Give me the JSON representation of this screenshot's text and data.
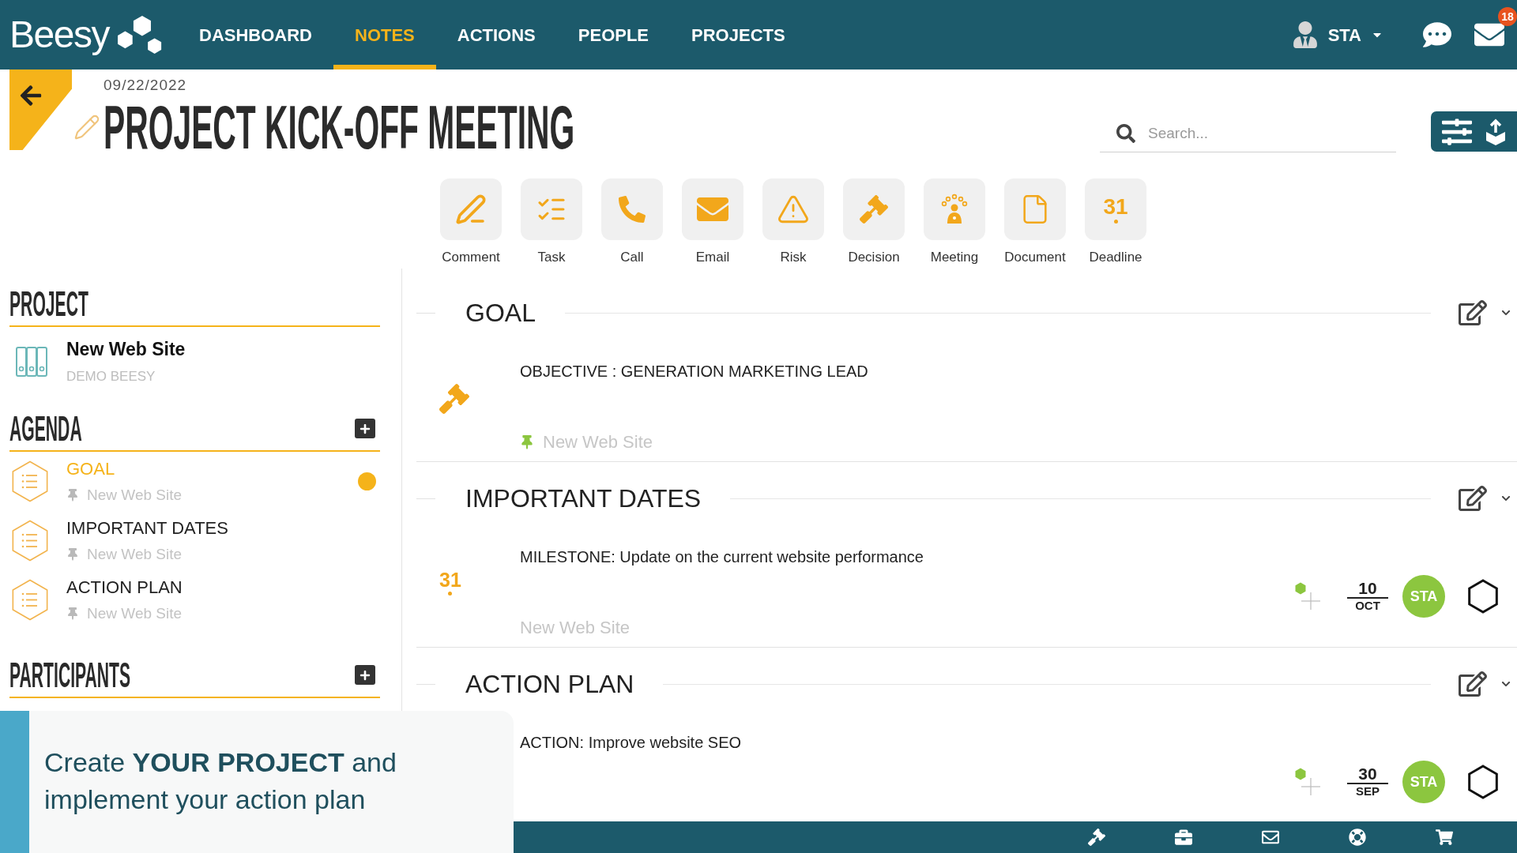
{
  "nav": {
    "logo": "Beesy",
    "items": [
      {
        "label": "DASHBOARD",
        "selected": false
      },
      {
        "label": "NOTES",
        "selected": true
      },
      {
        "label": "ACTIONS",
        "selected": false
      },
      {
        "label": "PEOPLE",
        "selected": false
      },
      {
        "label": "PROJECTS",
        "selected": false
      }
    ],
    "user": "STA",
    "mail_badge": "18"
  },
  "header": {
    "date": "09/22/2022",
    "title": "PROJECT KICK-OFF MEETING",
    "search": {
      "placeholder": "Search..."
    }
  },
  "toolbar": [
    {
      "label": "Comment"
    },
    {
      "label": "Task"
    },
    {
      "label": "Call"
    },
    {
      "label": "Email"
    },
    {
      "label": "Risk"
    },
    {
      "label": "Decision"
    },
    {
      "label": "Meeting"
    },
    {
      "label": "Document"
    },
    {
      "label": "Deadline",
      "icon_text": "31"
    }
  ],
  "sidebar": {
    "project": {
      "heading": "PROJECT",
      "name": "New Web Site",
      "client": "DEMO BEESY"
    },
    "agenda": {
      "heading": "AGENDA",
      "items": [
        {
          "title": "GOAL",
          "project": "New Web Site",
          "selected": true
        },
        {
          "title": "IMPORTANT DATES",
          "project": "New Web Site",
          "selected": false
        },
        {
          "title": "ACTION PLAN",
          "project": "New Web Site",
          "selected": false
        }
      ]
    },
    "participants": {
      "heading": "PARTICIPANTS"
    }
  },
  "sections": [
    {
      "title": "GOAL",
      "items": [
        {
          "kind": "decision",
          "text": "OBJECTIVE : GENERATION MARKETING LEAD",
          "project": "New Web Site",
          "pinned": true
        }
      ]
    },
    {
      "title": "IMPORTANT DATES",
      "items": [
        {
          "kind": "deadline",
          "icon_text": "31",
          "text": "MILESTONE: Update on the current website performance",
          "project": "New Web Site",
          "pinned": false,
          "due_day": "10",
          "due_month": "OCT",
          "assignee": "STA"
        }
      ]
    },
    {
      "title": "ACTION PLAN",
      "items": [
        {
          "kind": "action",
          "text": "ACTION: Improve website SEO",
          "due_day": "30",
          "due_month": "SEP",
          "assignee": "STA"
        }
      ]
    }
  ],
  "caption": "Create **YOUR PROJECT** and implement your action plan"
}
